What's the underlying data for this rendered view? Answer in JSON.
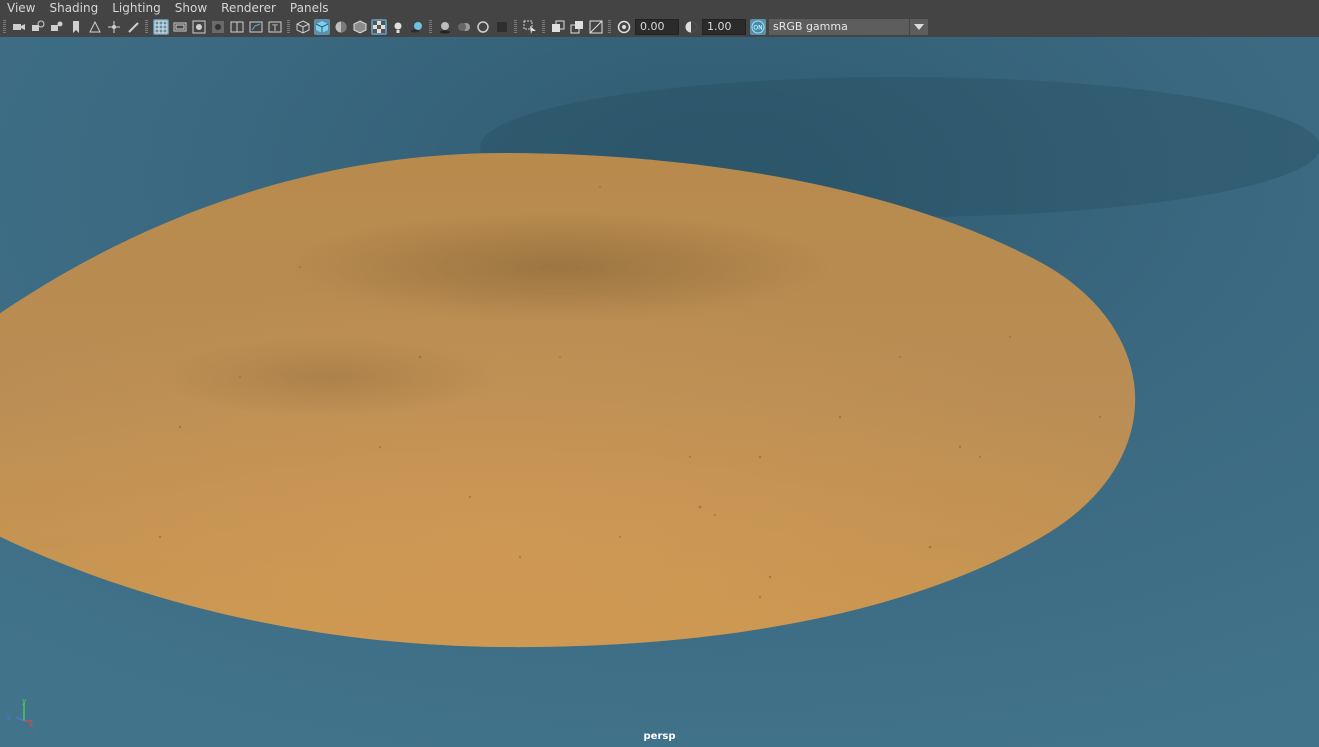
{
  "menu": [
    "View",
    "Shading",
    "Lighting",
    "Show",
    "Renderer",
    "Panels"
  ],
  "toolbar": {
    "exposure_value": "0.00",
    "gamma_value": "1.00",
    "color_space": "sRGB gamma",
    "colors": {
      "background": "#444444",
      "active": "#5d8fa8"
    }
  },
  "viewport": {
    "camera_label": "persp",
    "axis_y": "y",
    "axis_x": "x",
    "axis_z": "z",
    "colors": {
      "background": "#3f6f86",
      "object": "#c18f4e"
    }
  }
}
